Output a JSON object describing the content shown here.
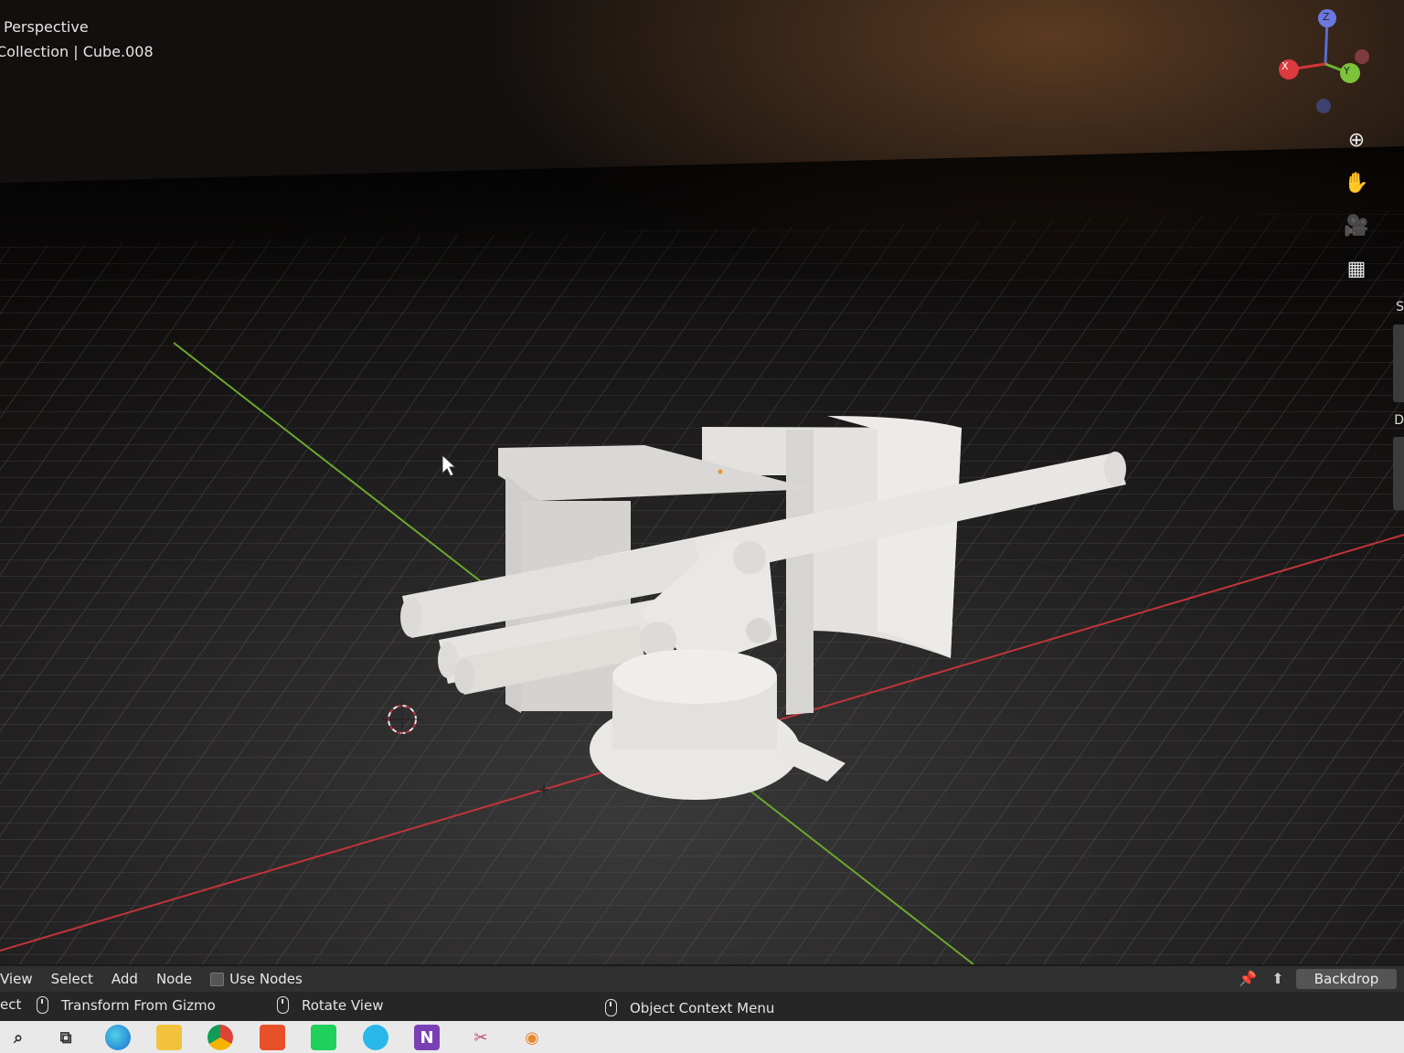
{
  "viewport": {
    "view_mode": "Perspective",
    "collection_path": "Collection | Cube.008",
    "gizmo": {
      "x_label": "X",
      "y_label": "Y",
      "z_label": "Z"
    },
    "nav_tools": [
      {
        "name": "zoom-icon",
        "glyph": "⊕"
      },
      {
        "name": "pan-hand-icon",
        "glyph": "✋"
      },
      {
        "name": "camera-icon",
        "glyph": "🎥"
      },
      {
        "name": "ortho-grid-icon",
        "glyph": "▦"
      }
    ],
    "side_tab_letters": [
      "S",
      "D"
    ]
  },
  "header": {
    "menus": [
      "View",
      "Select",
      "Add",
      "Node"
    ],
    "use_nodes_label": "Use Nodes",
    "backdrop_label": "Backdrop"
  },
  "status": {
    "left_partial": "ect",
    "transform_from_gizmo": "Transform From Gizmo",
    "rotate_view": "Rotate View",
    "object_context_menu": "Object Context Menu"
  },
  "taskbar": {
    "icons": [
      "search-icon",
      "task-view-icon",
      "edge-icon",
      "file-explorer-icon",
      "chrome-icon",
      "office-icon",
      "green-app-icon",
      "blue-app-icon",
      "onenote-icon",
      "snip-icon",
      "blender-icon"
    ],
    "onenote_letter": "N"
  },
  "colors": {
    "x_axis": "#d2363a",
    "y_axis": "#6bb52f",
    "model": "#e6e6e4"
  }
}
